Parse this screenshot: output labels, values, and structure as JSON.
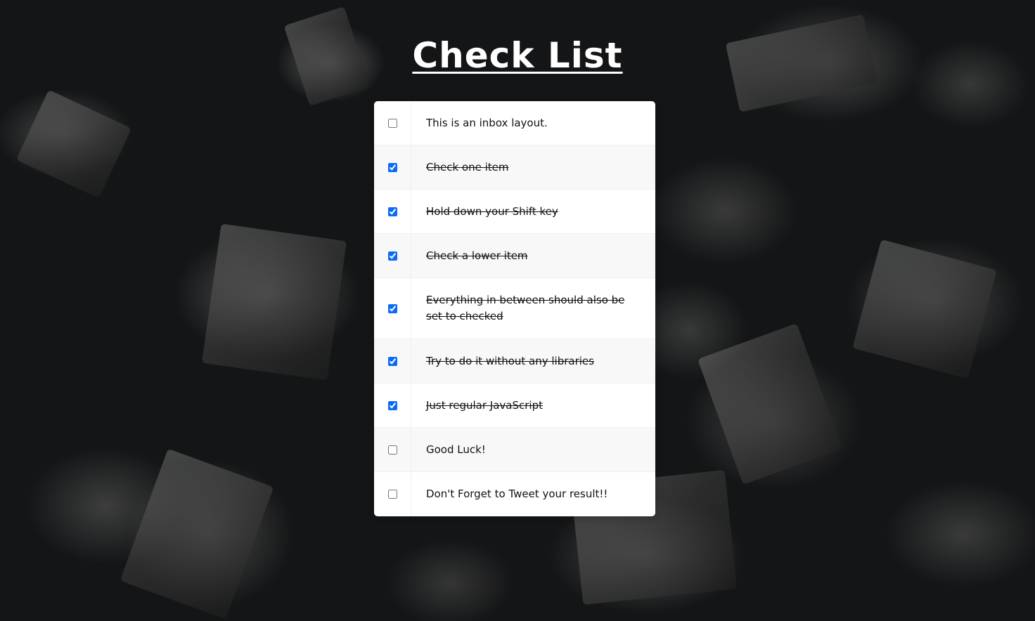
{
  "page": {
    "title": "Check List"
  },
  "inbox": {
    "items": [
      {
        "label": "This is an inbox layout.",
        "checked": false
      },
      {
        "label": "Check one item",
        "checked": true
      },
      {
        "label": "Hold down your Shift key",
        "checked": true
      },
      {
        "label": "Check a lower item",
        "checked": true
      },
      {
        "label": "Everything in between should also be set to checked",
        "checked": true
      },
      {
        "label": "Try to do it without any libraries",
        "checked": true
      },
      {
        "label": "Just regular JavaScript",
        "checked": true
      },
      {
        "label": "Good Luck!",
        "checked": false
      },
      {
        "label": "Don't Forget to Tweet your result!!",
        "checked": false
      }
    ]
  },
  "colors": {
    "checkbox_accent": "#0a6cf5",
    "panel_background": "#ffffff",
    "title_color": "#ffffff"
  }
}
